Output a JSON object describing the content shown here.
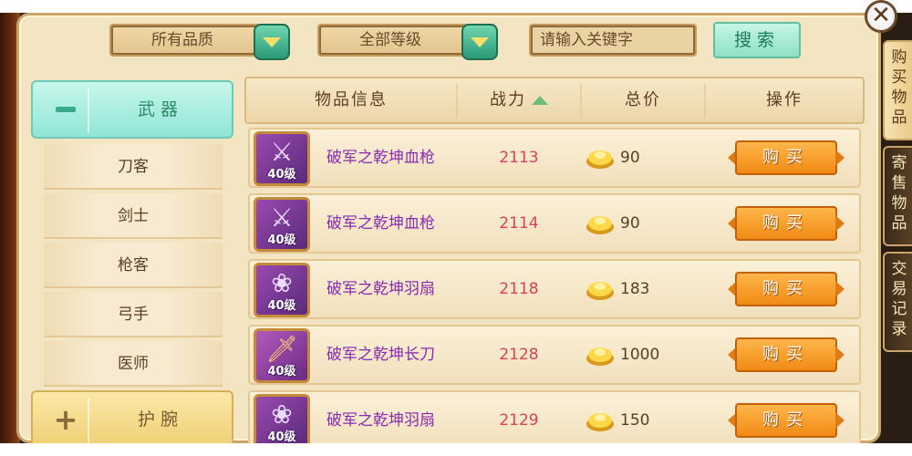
{
  "filters": {
    "quality": "所有品质",
    "level": "全部等级",
    "search_placeholder": "请输入关键字",
    "search_button": "搜索"
  },
  "sidebar": {
    "active_category": "武器",
    "active_sign": "−",
    "sub_items": [
      "刀客",
      "剑士",
      "枪客",
      "弓手",
      "医师"
    ],
    "next_category": "护腕",
    "next_sign": "+"
  },
  "table": {
    "headers": {
      "info": "物品信息",
      "power": "战力",
      "price": "总价",
      "action": "操作"
    },
    "rows": [
      {
        "icon": "spear-icon",
        "level": "40级",
        "name": "破军之乾坤血枪",
        "power": "2113",
        "price": "90",
        "buy": "购买"
      },
      {
        "icon": "spear-icon",
        "level": "40级",
        "name": "破军之乾坤血枪",
        "power": "2114",
        "price": "90",
        "buy": "购买"
      },
      {
        "icon": "feather-fan-icon",
        "level": "40级",
        "name": "破军之乾坤羽扇",
        "power": "2118",
        "price": "183",
        "buy": "购买"
      },
      {
        "icon": "broadsword-icon",
        "level": "40级",
        "name": "破军之乾坤长刀",
        "power": "2128",
        "price": "1000",
        "buy": "购买"
      },
      {
        "icon": "feather-fan-icon",
        "level": "40级",
        "name": "破军之乾坤羽扇",
        "power": "2129",
        "price": "150",
        "buy": "购买"
      }
    ]
  },
  "side_tabs": [
    "购买物品",
    "寄售物品",
    "交易记录"
  ],
  "close_label": "✕",
  "colors": {
    "item_name": "#8a2ab0",
    "power": "#d8405a",
    "buy_button": "#f08a14",
    "accent_green": "#3aa98a"
  }
}
